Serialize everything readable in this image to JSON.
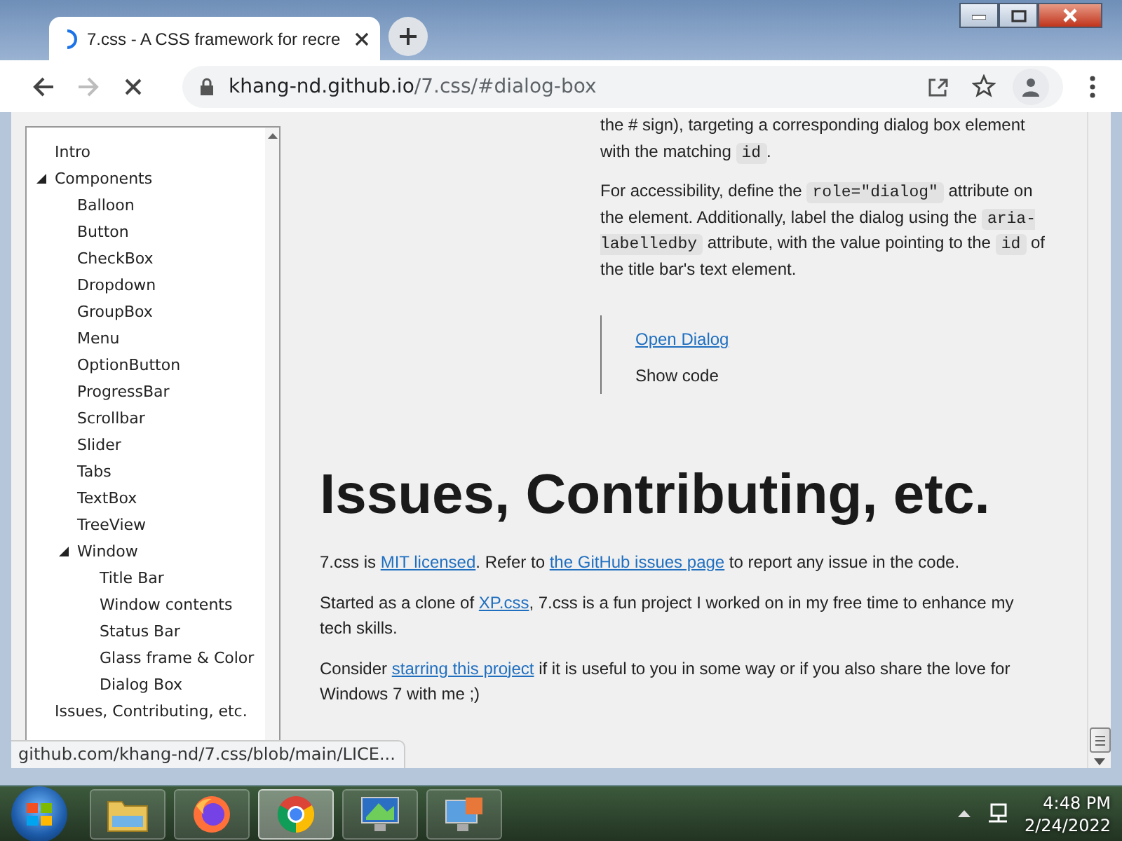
{
  "browser": {
    "tab": {
      "title": "7.css - A CSS framework for recre",
      "loading": true
    },
    "nav": {
      "back_disabled": false,
      "forward_disabled": true
    },
    "address": {
      "host": "khang-nd.github.io",
      "path": "/7.css/#dialog-box"
    }
  },
  "sidebar": {
    "items": [
      {
        "label": "Intro"
      },
      {
        "label": "Components",
        "expanded": true,
        "children": [
          {
            "label": "Balloon"
          },
          {
            "label": "Button"
          },
          {
            "label": "CheckBox"
          },
          {
            "label": "Dropdown"
          },
          {
            "label": "GroupBox"
          },
          {
            "label": "Menu"
          },
          {
            "label": "OptionButton"
          },
          {
            "label": "ProgressBar"
          },
          {
            "label": "Scrollbar"
          },
          {
            "label": "Slider"
          },
          {
            "label": "Tabs"
          },
          {
            "label": "TextBox"
          },
          {
            "label": "TreeView"
          },
          {
            "label": "Window",
            "expanded": true,
            "children": [
              {
                "label": "Title Bar"
              },
              {
                "label": "Window contents"
              },
              {
                "label": "Status Bar"
              },
              {
                "label": "Glass frame & Color"
              },
              {
                "label": "Dialog Box"
              }
            ]
          }
        ]
      },
      {
        "label": "Issues, Contributing, etc."
      }
    ]
  },
  "article": {
    "upper_paragraphs": [
      [
        {
          "kind": "text",
          "text": "the # sign), targeting a corresponding dialog box element"
        }
      ],
      [
        {
          "kind": "text",
          "text": "with the matching "
        },
        {
          "kind": "code",
          "text": "id"
        },
        {
          "kind": "text",
          "text": "."
        }
      ],
      [
        {
          "kind": "text",
          "text": "For accessibility, define the "
        },
        {
          "kind": "code",
          "text": "role=\"dialog\""
        },
        {
          "kind": "text",
          "text": " attribute on the element. Additionally, label the dialog using the "
        },
        {
          "kind": "code",
          "text": "aria-labelledby"
        },
        {
          "kind": "text",
          "text": " attribute, with the value pointing to the "
        },
        {
          "kind": "code",
          "text": "id"
        },
        {
          "kind": "text",
          "text": " of the title bar's text element."
        }
      ]
    ],
    "demo": {
      "link": "Open Dialog",
      "toggle": "Show code"
    },
    "heading": "Issues, Contributing, etc.",
    "paragraphs": [
      [
        {
          "kind": "text",
          "text": "7.css is "
        },
        {
          "kind": "link",
          "text": "MIT licensed"
        },
        {
          "kind": "text",
          "text": ". Refer to "
        },
        {
          "kind": "link",
          "text": "the GitHub issues page"
        },
        {
          "kind": "text",
          "text": " to report any issue in the code."
        }
      ],
      [
        {
          "kind": "text",
          "text": "Started as a clone of "
        },
        {
          "kind": "link",
          "text": "XP.css"
        },
        {
          "kind": "text",
          "text": ", 7.css is a fun project I worked on in my free time to enhance my tech skills."
        }
      ],
      [
        {
          "kind": "text",
          "text": "Consider "
        },
        {
          "kind": "link",
          "text": "starring this project"
        },
        {
          "kind": "text",
          "text": " if it is useful to you in some way or if you also share the love for Windows 7 with me ;)"
        }
      ]
    ]
  },
  "status_url": "github.com/khang-nd/7.css/blob/main/LICE...",
  "taskbar": {
    "apps": [
      {
        "kind": "folder",
        "selected": false
      },
      {
        "kind": "globe",
        "selected": false
      },
      {
        "kind": "ring",
        "selected": true
      },
      {
        "kind": "monitor",
        "selected": false
      },
      {
        "kind": "screen",
        "selected": false
      }
    ],
    "time": "4:48 PM",
    "date": "2/24/2022"
  }
}
